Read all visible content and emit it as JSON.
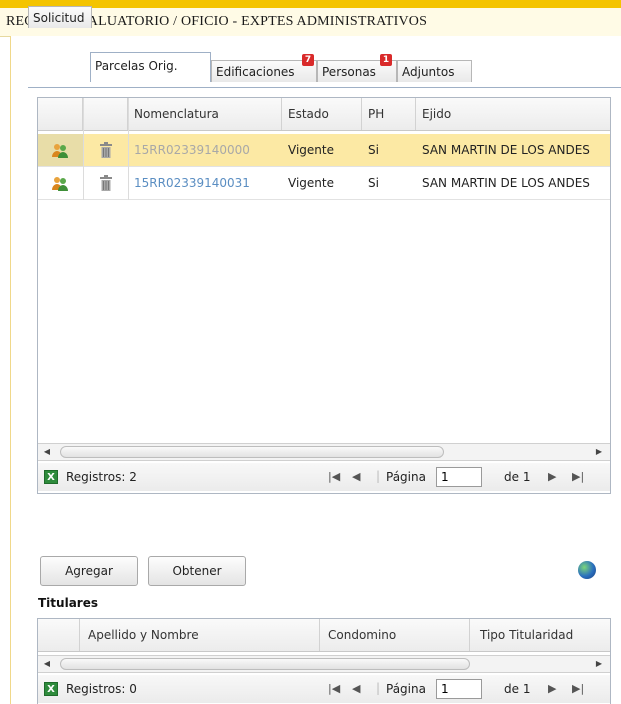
{
  "header": {
    "title": "RECLAMO VALUATORIO / OFICIO  -  EXPTES ADMINISTRATIVOS"
  },
  "tabs": [
    {
      "label": "Solicitud"
    },
    {
      "label": "Parcelas Orig."
    },
    {
      "label": "Edificaciones",
      "badge": "7"
    },
    {
      "label": "Personas",
      "badge": "1"
    },
    {
      "label": "Adjuntos"
    }
  ],
  "parcelas": {
    "columns": [
      "Nomenclatura",
      "Estado",
      "PH",
      "Ejido"
    ],
    "rows": [
      {
        "nomenclatura": "15RR02339140000",
        "estado": "Vigente",
        "ph": "Si",
        "ejido": "SAN MARTIN DE LOS ANDES"
      },
      {
        "nomenclatura": "15RR02339140031",
        "estado": "Vigente",
        "ph": "Si",
        "ejido": "SAN MARTIN DE LOS ANDES"
      }
    ],
    "pager": {
      "registros": "Registros: 2",
      "pagina_label": "Página",
      "pagina_value": "1",
      "de_label": "de 1"
    }
  },
  "actions": {
    "agregar": "Agregar",
    "obtener": "Obtener"
  },
  "titulares": {
    "title": "Titulares",
    "columns": [
      "Apellido y Nombre",
      "Condomino",
      "Tipo Titularidad"
    ],
    "pager": {
      "registros": "Registros: 0",
      "pagina_label": "Página",
      "pagina_value": "1",
      "de_label": "de 1"
    }
  },
  "icons": {
    "people": "people-icon",
    "trash": "trash-icon",
    "excel": "excel-export-icon",
    "globe": "globe-icon"
  },
  "colors": {
    "accent": "#f4c400",
    "selected_row": "#fce9a4",
    "link": "#5b8ec2",
    "badge": "#d92a2a"
  }
}
